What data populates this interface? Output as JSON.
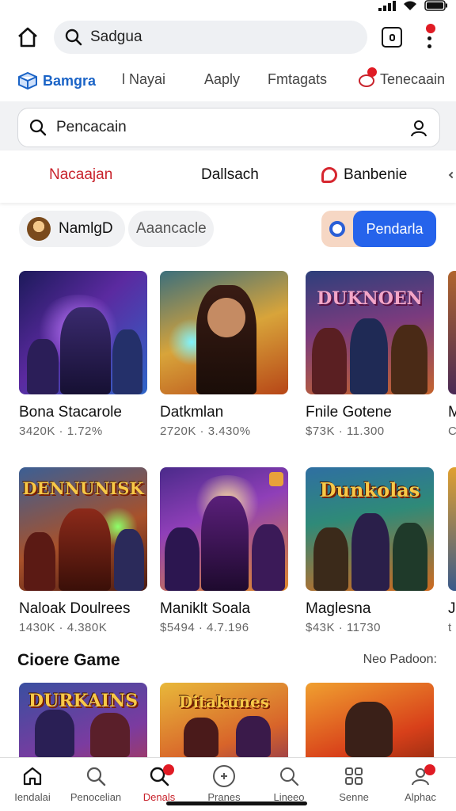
{
  "status_bar": {
    "signal_icon": "signal-icon",
    "wifi_icon": "wifi-icon",
    "battery_icon": "battery-icon"
  },
  "top_bar": {
    "search_value": "Sadgua"
  },
  "category_tabs": [
    {
      "label": "Bamgra",
      "active": true
    },
    {
      "label": "l Nayai",
      "active": false
    },
    {
      "label": "Aaply",
      "active": false
    },
    {
      "label": "Fmtagats",
      "active": false
    },
    {
      "label": "Tenecaain",
      "active": false
    }
  ],
  "search": {
    "value": "Pencacain"
  },
  "filter_tabs": [
    {
      "label": "Nacaajan",
      "active": true
    },
    {
      "label": "Dallsach",
      "active": false
    },
    {
      "label": "Banbenie",
      "active": false
    }
  ],
  "chips": {
    "profile": "NamlgD",
    "secondary": "Aaancacle",
    "toggle_button": "Pendarla"
  },
  "games_row1": [
    {
      "title": "Bona Stacarole",
      "meta": "3420K · 1.72%"
    },
    {
      "title": "Datkmlan",
      "meta": "2720K · 3.430%"
    },
    {
      "title": "Fnile Gotene",
      "meta": "$73K · 11.300",
      "art": "DUKNOEN"
    },
    {
      "title": "M",
      "meta": "C"
    }
  ],
  "games_row2": [
    {
      "title": "Naloak Doulrees",
      "meta": "1430K · 4.380K",
      "art": "DENNUNISK"
    },
    {
      "title": "Maniklt Soala",
      "meta": "$5494 · 4.7.196"
    },
    {
      "title": "Maglesna",
      "meta": "$43K · 11730",
      "art": "Dunkolas"
    },
    {
      "title": "J",
      "meta": "t"
    }
  ],
  "section": {
    "title": "Cioere Game",
    "link": "Neo Padoon:"
  },
  "games_row3": [
    {
      "art": "DURKAINS"
    },
    {
      "art": "Ditakunes"
    },
    {
      "art": ""
    }
  ],
  "bottom_nav": [
    {
      "label": "Iendalai",
      "active": false
    },
    {
      "label": "Penocelian",
      "active": false
    },
    {
      "label": "Denals",
      "active": true
    },
    {
      "label": "Pranes",
      "active": false
    },
    {
      "label": "Lineeo",
      "active": false
    },
    {
      "label": "Senne",
      "active": false
    },
    {
      "label": "Alphac",
      "active": false
    }
  ],
  "colors": {
    "accent_blue": "#2563eb",
    "accent_red": "#c8232c",
    "badge_red": "#e01b24"
  }
}
